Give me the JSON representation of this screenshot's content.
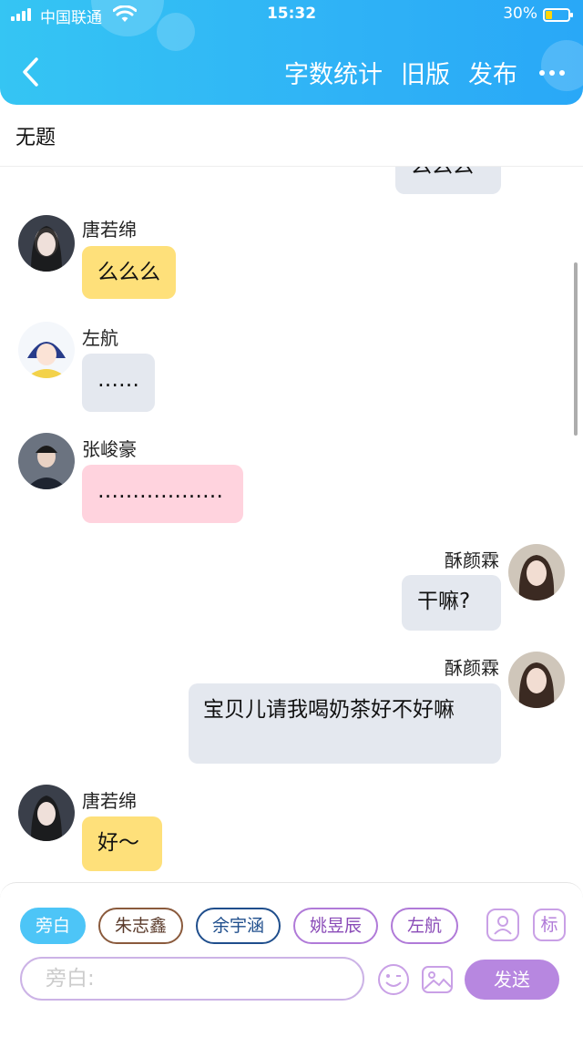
{
  "status": {
    "carrier": "中国联通",
    "time": "15:32",
    "battery": "30%",
    "battery_level": 0.3
  },
  "header": {
    "actions": [
      "字数统计",
      "旧版",
      "发布"
    ]
  },
  "title": "无题",
  "messages": [
    {
      "side": "right",
      "text": "么么么",
      "partial": true
    },
    {
      "side": "left",
      "name": "唐若绵",
      "text": "么么么",
      "color": "yellow"
    },
    {
      "side": "left",
      "name": "左航",
      "text": "……",
      "color": "gray"
    },
    {
      "side": "left",
      "name": "张峻豪",
      "text": "………………",
      "color": "pink"
    },
    {
      "side": "right",
      "name": "酥颜霖",
      "text": "干嘛?",
      "color": "gray"
    },
    {
      "side": "right",
      "name": "酥颜霖",
      "text": "宝贝儿请我喝奶茶好不好嘛",
      "color": "gray"
    },
    {
      "side": "left",
      "name": "唐若绵",
      "text": "好～",
      "color": "yellow"
    }
  ],
  "chips": [
    "旁白",
    "朱志鑫",
    "余宇涵",
    "姚昱辰",
    "左航"
  ],
  "side_icons": {
    "tag": "标"
  },
  "input": {
    "placeholder": "旁白:"
  },
  "send_label": "发送",
  "icons": [
    "back-icon",
    "more-icon",
    "contact-icon",
    "emoji-icon",
    "image-icon"
  ]
}
